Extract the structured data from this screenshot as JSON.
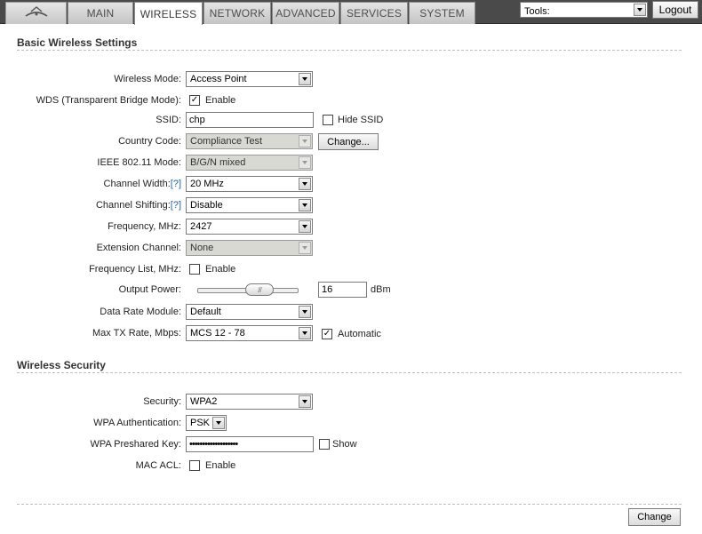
{
  "nav": {
    "logo_icon": "ubiquiti-logo-icon",
    "tabs": [
      {
        "label": "MAIN"
      },
      {
        "label": "WIRELESS",
        "active": true
      },
      {
        "label": "NETWORK"
      },
      {
        "label": "ADVANCED"
      },
      {
        "label": "SERVICES"
      },
      {
        "label": "SYSTEM"
      }
    ],
    "tools_value": "Tools:",
    "logout_label": "Logout"
  },
  "basic": {
    "title": "Basic Wireless Settings",
    "wireless_mode": {
      "label": "Wireless Mode:",
      "value": "Access Point"
    },
    "wds": {
      "label": "WDS (Transparent Bridge Mode):",
      "checked": true,
      "option": "Enable"
    },
    "ssid": {
      "label": "SSID:",
      "value": "chp",
      "hide_label": "Hide SSID",
      "hide_checked": false
    },
    "country": {
      "label": "Country Code:",
      "value": "Compliance Test",
      "button": "Change..."
    },
    "ieee": {
      "label": "IEEE 802.11 Mode:",
      "value": "B/G/N mixed"
    },
    "channel_width": {
      "label": "Channel Width:",
      "help": "[?]",
      "value": "20 MHz"
    },
    "channel_shifting": {
      "label": "Channel Shifting:",
      "help": "[?]",
      "value": "Disable"
    },
    "frequency": {
      "label": "Frequency, MHz:",
      "value": "2427"
    },
    "extension_channel": {
      "label": "Extension Channel:",
      "value": "None"
    },
    "frequency_list": {
      "label": "Frequency List, MHz:",
      "checked": false,
      "option": "Enable"
    },
    "output_power": {
      "label": "Output Power:",
      "value": "16",
      "unit": "dBm",
      "slider_grip": "///"
    },
    "data_rate_module": {
      "label": "Data Rate Module:",
      "value": "Default"
    },
    "max_tx_rate": {
      "label": "Max TX Rate, Mbps:",
      "value": "MCS 12 - 78",
      "auto_label": "Automatic",
      "auto_checked": true
    }
  },
  "security": {
    "title": "Wireless Security",
    "security": {
      "label": "Security:",
      "value": "WPA2"
    },
    "wpa_auth": {
      "label": "WPA Authentication:",
      "value": "PSK"
    },
    "wpa_key": {
      "label": "WPA Preshared Key:",
      "value": "•••••••••••••••••••",
      "show_label": "Show",
      "show_checked": false
    },
    "mac_acl": {
      "label": "MAC ACL:",
      "checked": false,
      "option": "Enable"
    }
  },
  "footer": {
    "change_label": "Change"
  }
}
